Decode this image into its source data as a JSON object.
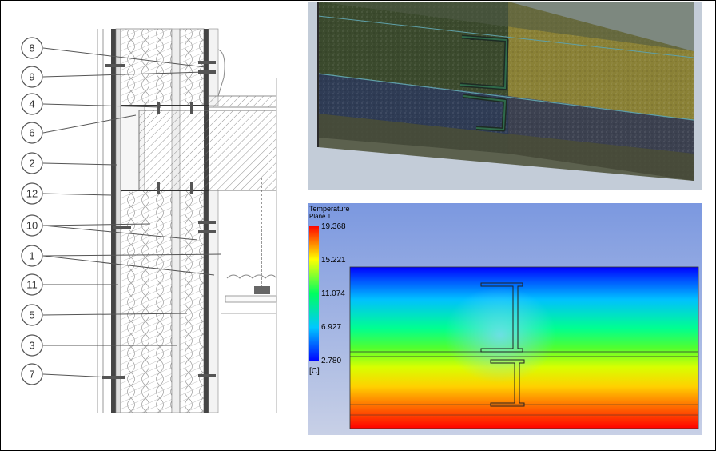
{
  "section_drawing": {
    "callouts": [
      {
        "label": "8"
      },
      {
        "label": "9"
      },
      {
        "label": "4"
      },
      {
        "label": "6"
      },
      {
        "label": "2"
      },
      {
        "label": "12"
      },
      {
        "label": "10"
      },
      {
        "label": "1"
      },
      {
        "label": "11"
      },
      {
        "label": "5"
      },
      {
        "label": "3"
      },
      {
        "label": "7"
      }
    ]
  },
  "mesh_view": {
    "colors": {
      "upper_left": "#3a4a2e",
      "upper_right": "#8c8238",
      "lower_left": "#2e3b55",
      "lower_right": "#3b4150",
      "frame": "#2f6a4a"
    }
  },
  "thermal_view": {
    "legend": {
      "title": "Temperature",
      "subtitle": "Plane 1",
      "ticks": [
        "19.368",
        "15.221",
        "11.074",
        "6.927",
        "2.780"
      ],
      "unit": "[C]"
    },
    "colors": {
      "background_top": "#7f9be0",
      "background_bottom": "#c7d0e6",
      "hot": "#ff0000",
      "cold": "#0000ff"
    }
  }
}
